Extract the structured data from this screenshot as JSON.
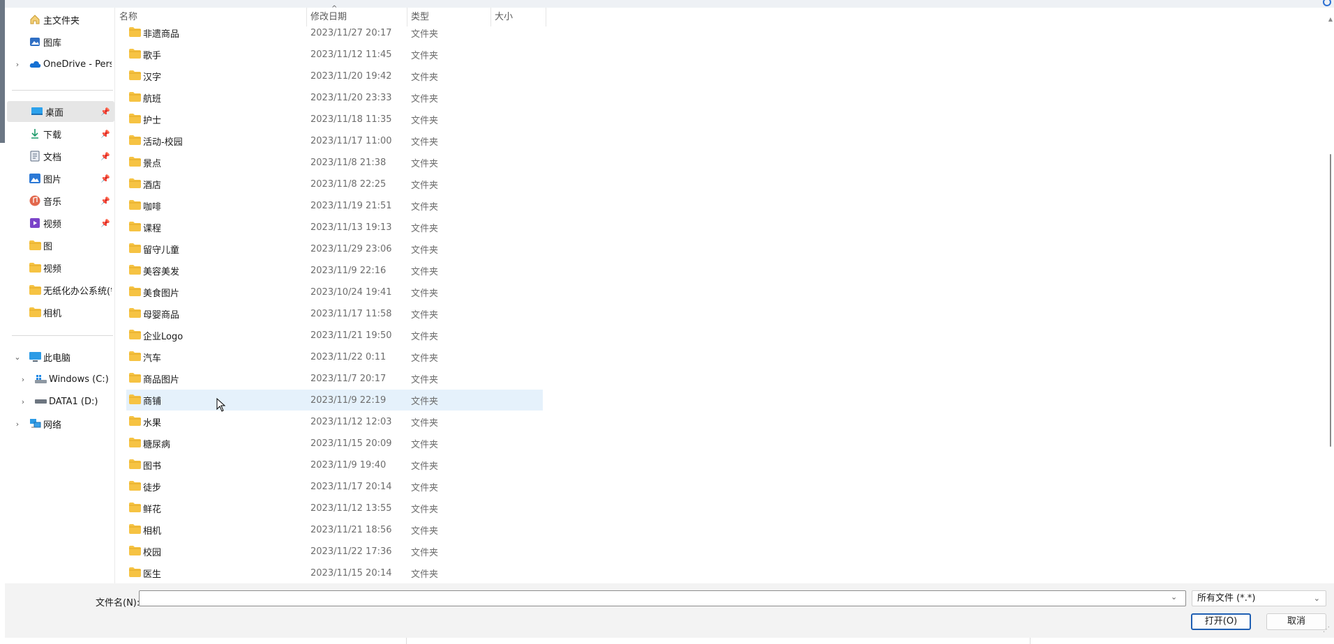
{
  "sidebar": {
    "quick_items": [
      {
        "label": "主文件夹",
        "icon": "home-icon"
      },
      {
        "label": "图库",
        "icon": "gallery-icon"
      },
      {
        "label": "OneDrive - Perso",
        "icon": "cloud-icon",
        "expander": "›"
      }
    ],
    "pinned_items": [
      {
        "label": "桌面",
        "icon": "desktop-icon",
        "selected": true
      },
      {
        "label": "下载",
        "icon": "download-icon"
      },
      {
        "label": "文档",
        "icon": "document-icon"
      },
      {
        "label": "图片",
        "icon": "pictures-icon"
      },
      {
        "label": "音乐",
        "icon": "music-icon"
      },
      {
        "label": "视频",
        "icon": "video-icon"
      },
      {
        "label": "图",
        "icon": "folder-icon"
      },
      {
        "label": "视频",
        "icon": "folder-icon"
      },
      {
        "label": "无纸化办公系统(需",
        "icon": "folder-icon"
      },
      {
        "label": "相机",
        "icon": "folder-icon"
      }
    ],
    "pin_glyph": "📌",
    "this_pc": {
      "label": "此电脑",
      "icon": "computer-icon",
      "expander": "⌄"
    },
    "drives": [
      {
        "label": "Windows (C:)",
        "icon": "windows-drive-icon",
        "expander": "›"
      },
      {
        "label": "DATA1 (D:)",
        "icon": "drive-icon",
        "expander": "›"
      }
    ],
    "network": {
      "label": "网络",
      "icon": "network-icon",
      "expander": "›"
    }
  },
  "columns": {
    "name": "名称",
    "modified": "修改日期",
    "type": "类型",
    "size": "大小",
    "sort_indicator": "^"
  },
  "files": [
    {
      "name": "非遗商品",
      "date": "2023/11/27 20:17",
      "type": "文件夹"
    },
    {
      "name": "歌手",
      "date": "2023/11/12 11:45",
      "type": "文件夹"
    },
    {
      "name": "汉字",
      "date": "2023/11/20 19:42",
      "type": "文件夹"
    },
    {
      "name": "航班",
      "date": "2023/11/20 23:33",
      "type": "文件夹"
    },
    {
      "name": "护士",
      "date": "2023/11/18 11:35",
      "type": "文件夹"
    },
    {
      "name": "活动-校园",
      "date": "2023/11/17 11:00",
      "type": "文件夹"
    },
    {
      "name": "景点",
      "date": "2023/11/8 21:38",
      "type": "文件夹"
    },
    {
      "name": "酒店",
      "date": "2023/11/8 22:25",
      "type": "文件夹"
    },
    {
      "name": "咖啡",
      "date": "2023/11/19 21:51",
      "type": "文件夹"
    },
    {
      "name": "课程",
      "date": "2023/11/13 19:13",
      "type": "文件夹"
    },
    {
      "name": "留守儿童",
      "date": "2023/11/29 23:06",
      "type": "文件夹"
    },
    {
      "name": "美容美发",
      "date": "2023/11/9 22:16",
      "type": "文件夹"
    },
    {
      "name": "美食图片",
      "date": "2023/10/24 19:41",
      "type": "文件夹"
    },
    {
      "name": "母婴商品",
      "date": "2023/11/17 11:58",
      "type": "文件夹"
    },
    {
      "name": "企业Logo",
      "date": "2023/11/21 19:50",
      "type": "文件夹"
    },
    {
      "name": "汽车",
      "date": "2023/11/22 0:11",
      "type": "文件夹"
    },
    {
      "name": "商品图片",
      "date": "2023/11/7 20:17",
      "type": "文件夹"
    },
    {
      "name": "商铺",
      "date": "2023/11/9 22:19",
      "type": "文件夹",
      "hover": true
    },
    {
      "name": "水果",
      "date": "2023/11/12 12:03",
      "type": "文件夹"
    },
    {
      "name": "糖尿病",
      "date": "2023/11/15 20:09",
      "type": "文件夹"
    },
    {
      "name": "图书",
      "date": "2023/11/9 19:40",
      "type": "文件夹"
    },
    {
      "name": "徒步",
      "date": "2023/11/17 20:14",
      "type": "文件夹"
    },
    {
      "name": "鲜花",
      "date": "2023/11/12 13:55",
      "type": "文件夹"
    },
    {
      "name": "相机",
      "date": "2023/11/21 18:56",
      "type": "文件夹"
    },
    {
      "name": "校园",
      "date": "2023/11/22 17:36",
      "type": "文件夹"
    },
    {
      "name": "医生",
      "date": "2023/11/15 20:14",
      "type": "文件夹"
    }
  ],
  "footer": {
    "filename_label": "文件名(N):",
    "filename_value": "",
    "filetype_value": "所有文件 (*.*)",
    "open_label": "打开(O)",
    "cancel_label": "取消"
  },
  "colors": {
    "accent": "#1f5fb3",
    "selected_bg": "#e6e6e6",
    "hover_bg": "#e5f1fb",
    "folder": "#f6c343"
  }
}
